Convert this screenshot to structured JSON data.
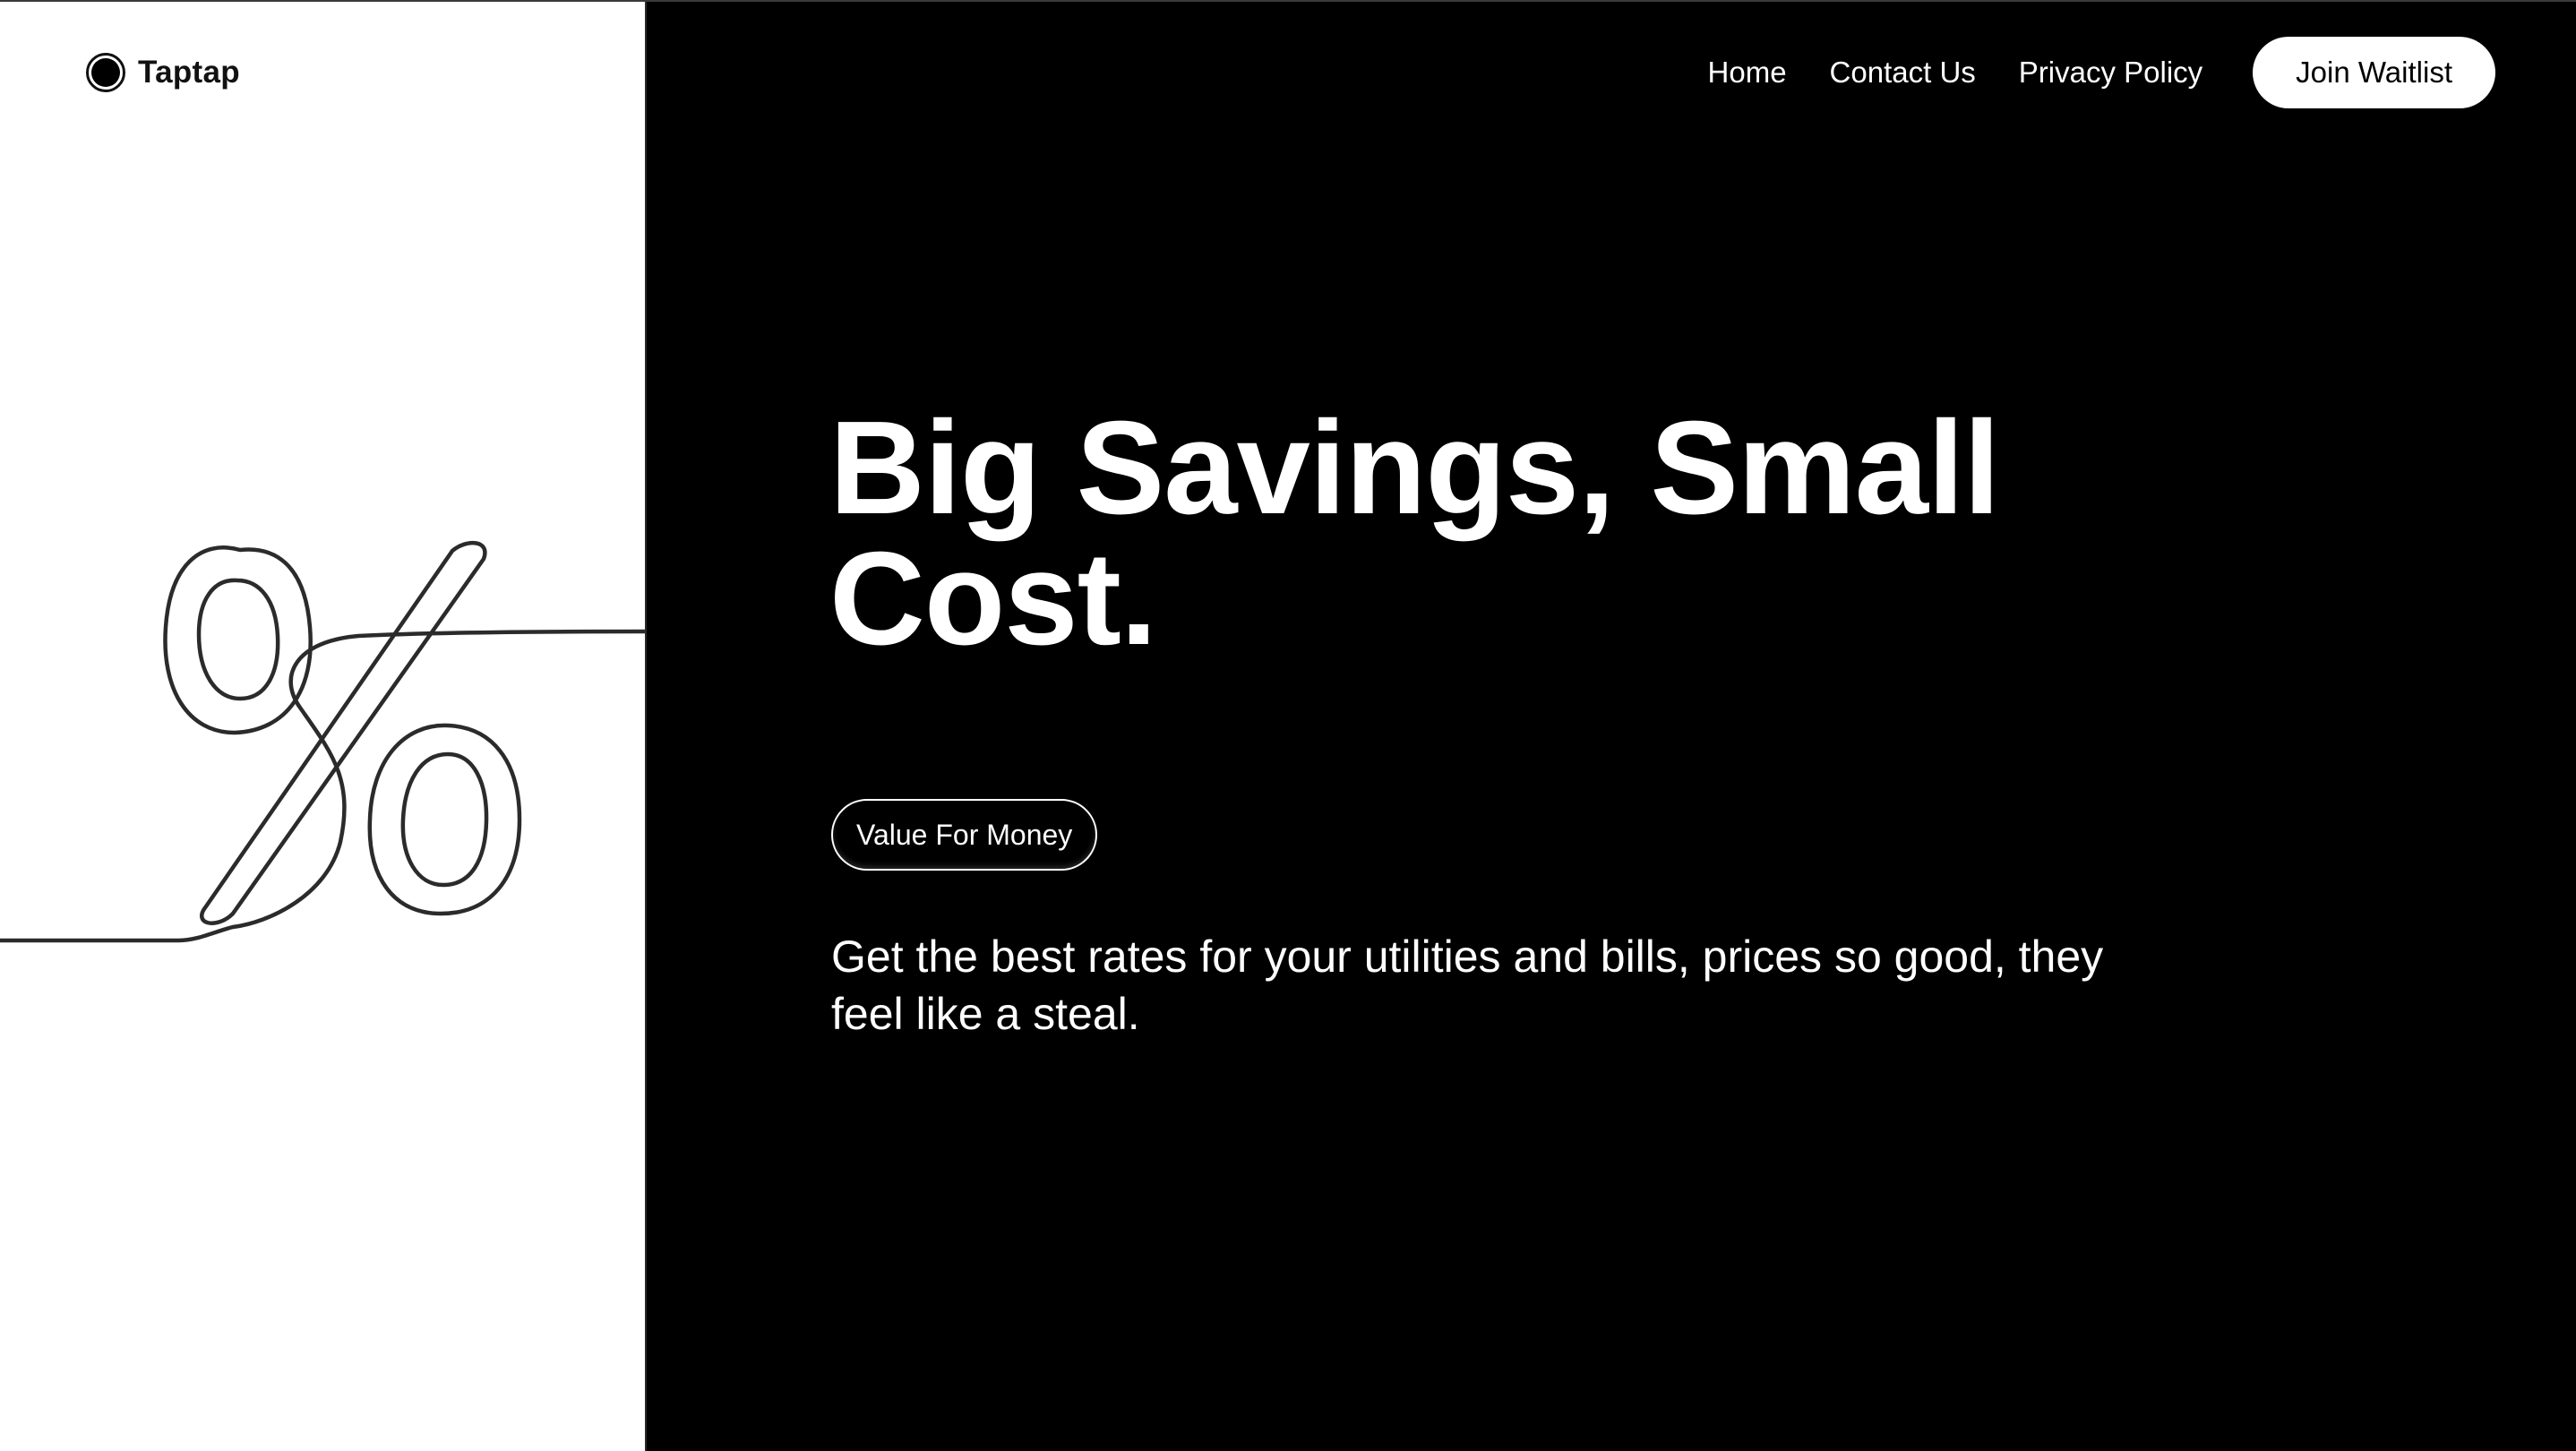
{
  "brand": {
    "name": "Taptap",
    "logo_icon": "circle-logo-icon"
  },
  "nav": {
    "links": [
      {
        "label": "Home"
      },
      {
        "label": "Contact Us"
      },
      {
        "label": "Privacy Policy"
      }
    ],
    "cta_label": "Join Waitlist"
  },
  "hero": {
    "title": "Big Savings, Small Cost.",
    "badge": "Value For Money",
    "subtitle": "Get the best rates for your utilities and bills, prices so good, they feel like a steal."
  },
  "illustration": {
    "icon": "percent-line-art-icon"
  },
  "colors": {
    "left_background": "#ffffff",
    "right_background": "#000000",
    "text_light": "#ffffff",
    "text_dark": "#111111"
  }
}
